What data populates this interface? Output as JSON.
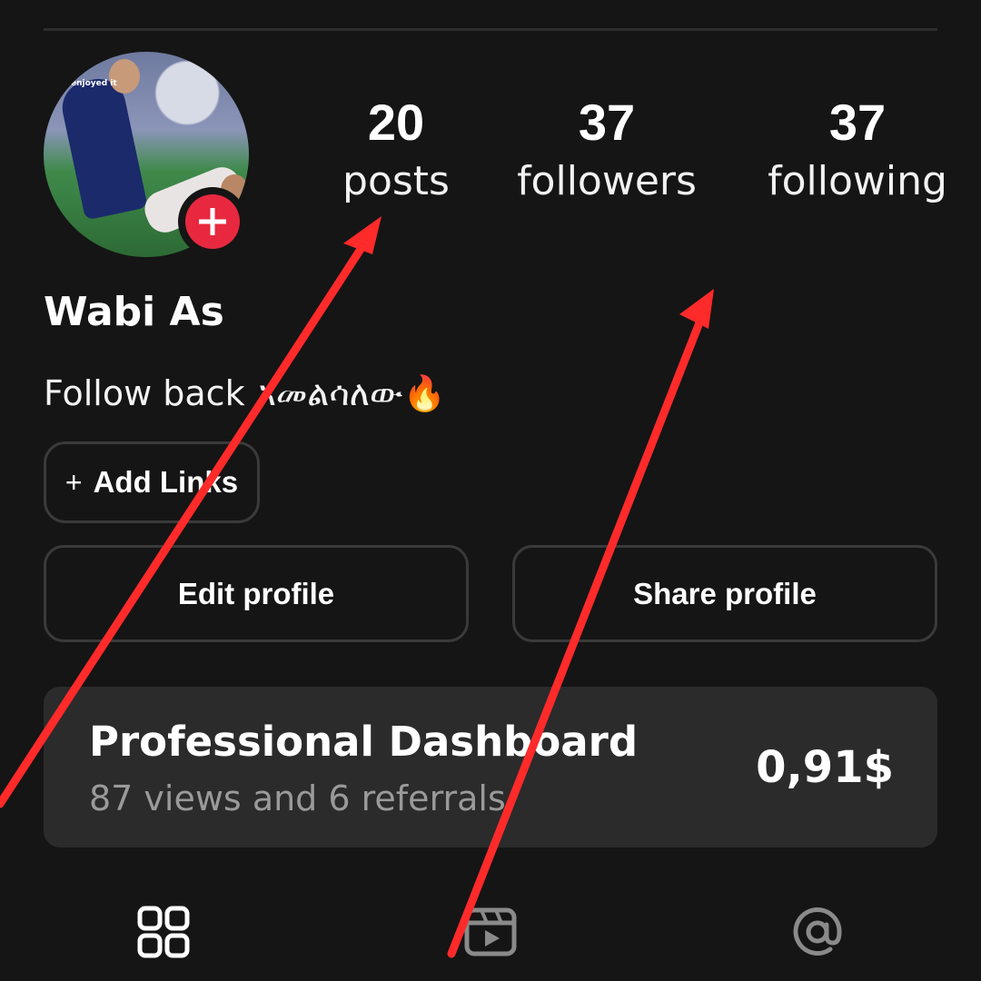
{
  "profile": {
    "name": "Wabi As",
    "bio": "Follow back አመልሳለው🔥",
    "avatar_watermark": "enjoyed it"
  },
  "stats": [
    {
      "value": "20",
      "label": "posts"
    },
    {
      "value": "37",
      "label": "followers"
    },
    {
      "value": "37",
      "label": "following"
    }
  ],
  "buttons": {
    "add_links": "Add Links",
    "edit_profile": "Edit profile",
    "share_profile": "Share profile"
  },
  "dashboard": {
    "title": "Professional Dashboard",
    "subtitle": "87 views and 6 referrals",
    "amount": "0,91$"
  },
  "tabs": [
    "grid-icon",
    "reels-icon",
    "mentions-icon"
  ],
  "colors": {
    "background": "#151515",
    "accent_red": "#e8283f",
    "annotation_red": "#ff2a2a",
    "card": "#2b2b2b"
  }
}
